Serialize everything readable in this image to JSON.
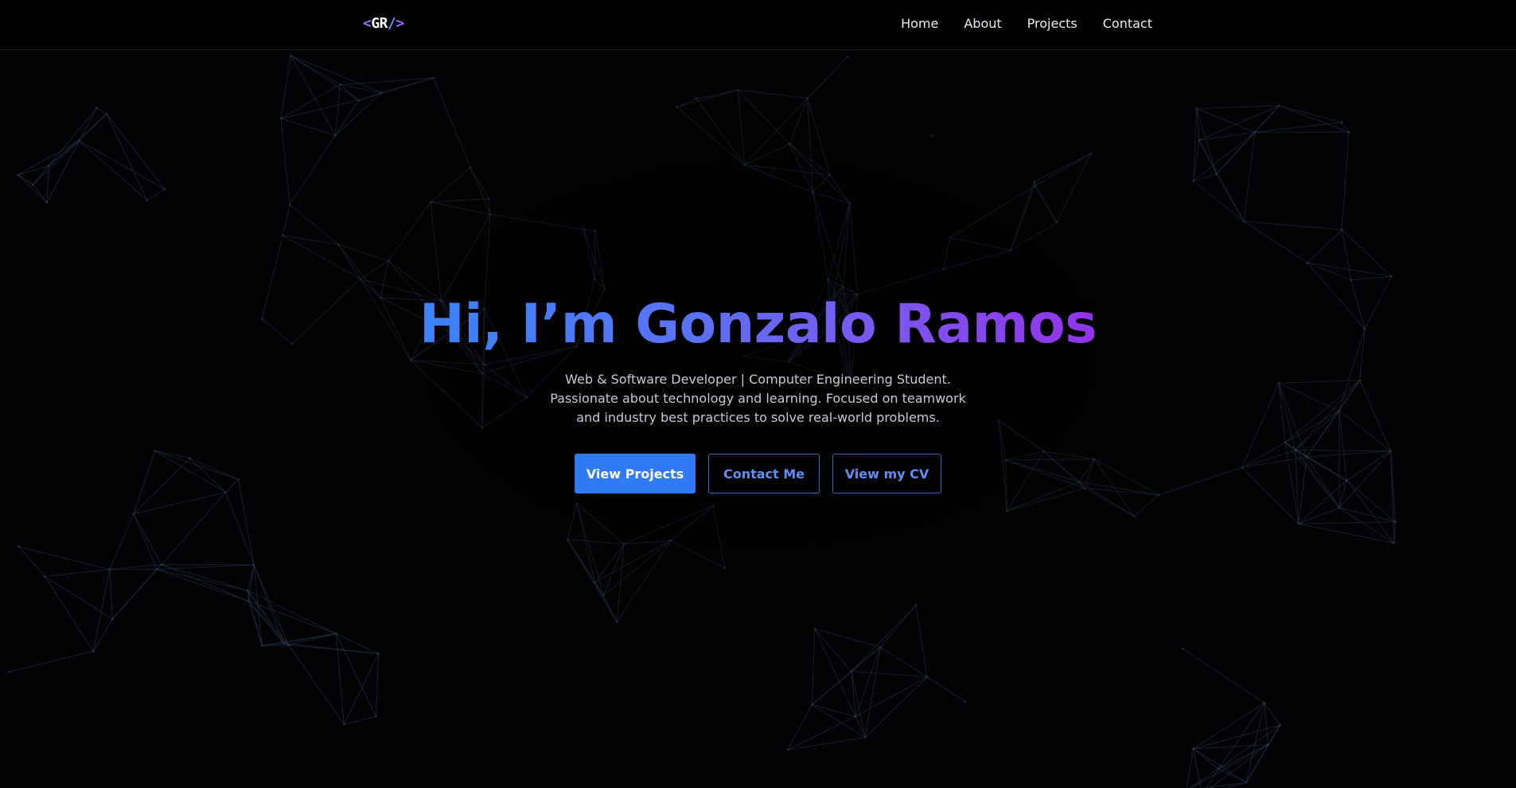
{
  "logo": {
    "lt": "<",
    "text": "GR",
    "slash": "/",
    "gt": ">"
  },
  "nav": {
    "items": [
      {
        "label": "Home"
      },
      {
        "label": "About"
      },
      {
        "label": "Projects"
      },
      {
        "label": "Contact"
      }
    ]
  },
  "hero": {
    "title": "Hi, I’m Gonzalo Ramos",
    "subtitle_lines": [
      "Web & Software Developer | Computer Engineering Student.",
      "Passionate about technology and learning. Focused on teamwork",
      "and industry best practices to solve real-world problems."
    ],
    "buttons": {
      "view_projects": "View Projects",
      "contact_me": "Contact Me",
      "view_cv": "View my CV"
    }
  },
  "colors": {
    "background": "#020204",
    "accent_blue": "#2f7bf5",
    "gradient_start": "#3a82f6",
    "gradient_end": "#9333ea",
    "logo_purple": "#9b6bff",
    "network_lines": "#2b3a5a"
  }
}
